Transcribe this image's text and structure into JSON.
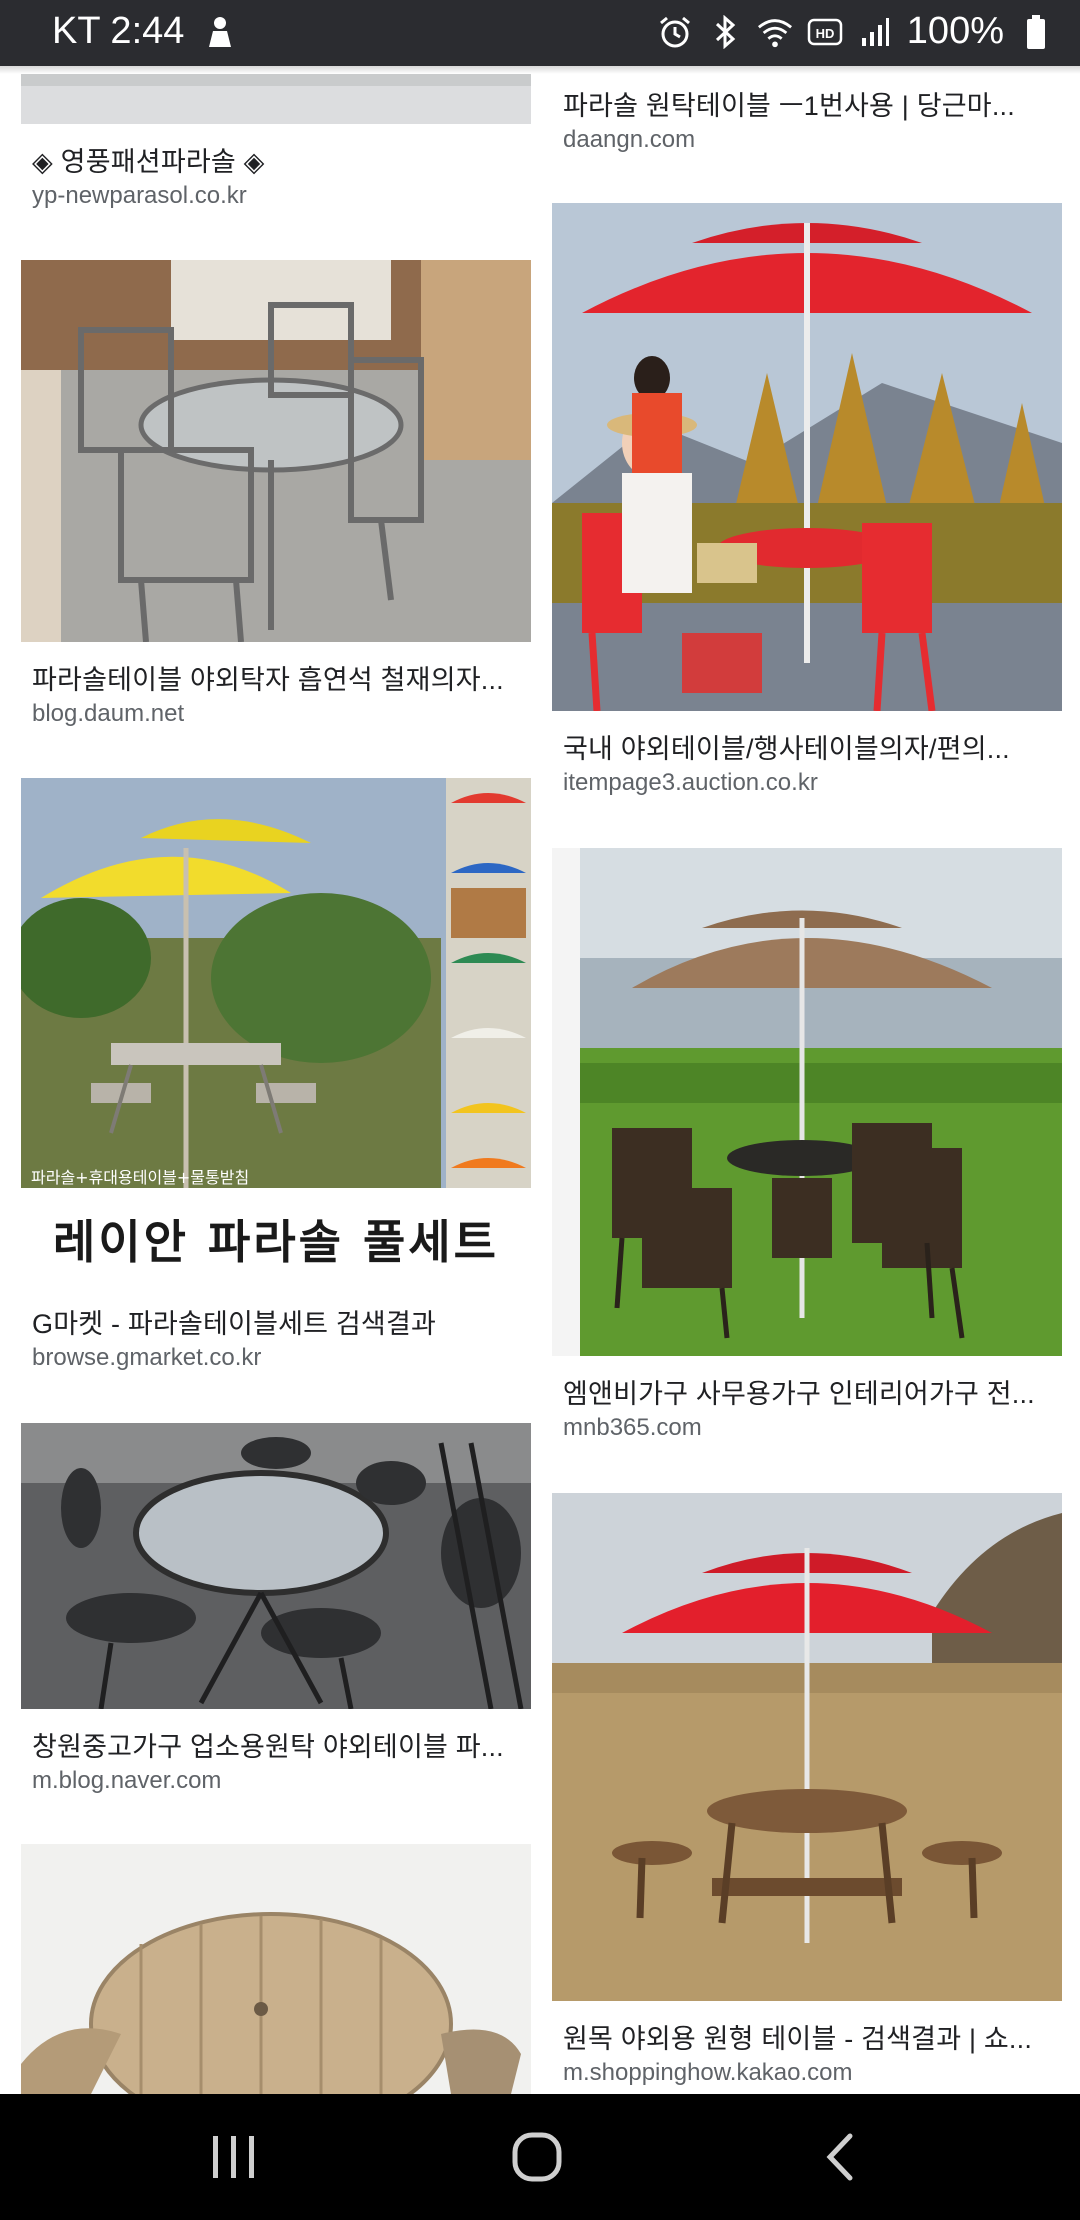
{
  "status_bar": {
    "carrier_time": "KT 2:44",
    "battery": "100%",
    "icons": [
      "notification-icon",
      "alarm-icon",
      "bluetooth-icon",
      "wifi-icon",
      "hd-icon",
      "signal-icon",
      "battery-icon"
    ]
  },
  "results": {
    "left": [
      {
        "title": "◈ 영풍패션파라솔 ◈",
        "source": "yp-newparasol.co.kr"
      },
      {
        "title": "파라솔테이블 야외탁자 흡연석 철재의자...",
        "source": "blog.daum.net"
      },
      {
        "title": "G마켓 - 파라솔테이블세트 검색결과",
        "source": "browse.gmarket.co.kr",
        "image_caption": "레이안 파라솔 풀세트",
        "image_subcaption": "파라솔+휴대용테이블+물통받침"
      },
      {
        "title": "창원중고가구 업소용원탁 야외테이블 파...",
        "source": "m.blog.naver.com"
      },
      {
        "title": "",
        "source": ""
      }
    ],
    "right": [
      {
        "title": "파라솔 원탁테이블 ㅡ1번사용 | 당근마...",
        "source": "daangn.com"
      },
      {
        "title": "국내 야외테이블/행사테이블의자/편의...",
        "source": "itempage3.auction.co.kr"
      },
      {
        "title": "엠앤비가구 사무용가구 인테리어가구 전...",
        "source": "mnb365.com"
      },
      {
        "title": "원목 야외용 원형 테이블 - 검색결과 | 쇼...",
        "source": "m.shoppinghow.kakao.com"
      }
    ]
  },
  "nav_bar": {
    "buttons": [
      "recents-button",
      "home-button",
      "back-button"
    ]
  },
  "colors": {
    "status_bar_bg": "#2b2c30",
    "title_text": "#202124",
    "source_text": "#5f6368",
    "nav_bar_bg": "#000000"
  }
}
